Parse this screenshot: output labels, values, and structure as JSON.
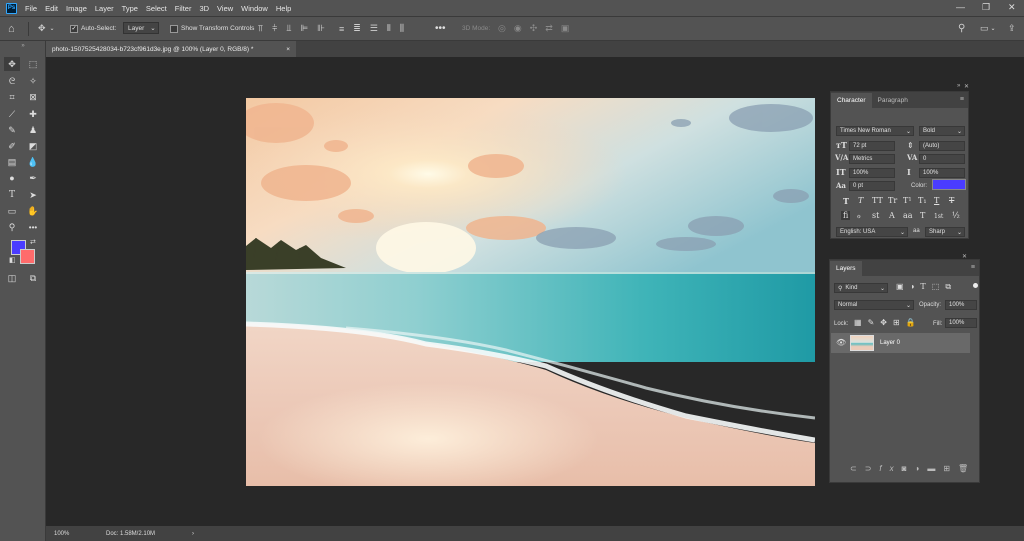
{
  "app": {
    "logo": "Ps"
  },
  "menu": [
    "File",
    "Edit",
    "Image",
    "Layer",
    "Type",
    "Select",
    "Filter",
    "3D",
    "View",
    "Window",
    "Help"
  ],
  "options": {
    "auto_select_label": "Auto-Select:",
    "auto_select_value": "Layer",
    "transform_label": "Show Transform Controls",
    "mode_3d": "3D Mode:"
  },
  "document": {
    "tab_title": "photo-1507525428034-b723cf961d3e.jpg @ 100% (Layer 0, RGB/8) *",
    "close": "×",
    "zoom": "100%",
    "doc_info": "Doc: 1.58M/2.10M",
    "arrow": "›"
  },
  "colors": {
    "foreground": "#4a3cff",
    "background": "#ff6b6b",
    "font_color": "#4a3cff"
  },
  "character": {
    "tabs": [
      "Character",
      "Paragraph"
    ],
    "font_family": "Times New Roman",
    "font_style": "Bold",
    "size": "72 pt",
    "leading": "(Auto)",
    "kerning": "Metrics",
    "tracking": "0",
    "vscale": "100%",
    "hscale": "100%",
    "baseline": "0 pt",
    "color_label": "Color:",
    "type_buttons": [
      "T",
      "T",
      "TT",
      "Tr",
      "T¹",
      "T₁",
      "T",
      "T"
    ],
    "ot_buttons": [
      "fi",
      "ℴ",
      "st",
      "A",
      "aa",
      "T",
      "1st",
      "½"
    ],
    "language": "English: USA",
    "antialias": "Sharp"
  },
  "layers": {
    "title": "Layers",
    "filter": "Kind",
    "blend_mode": "Normal",
    "opacity_label": "Opacity:",
    "opacity": "100%",
    "lock_label": "Lock:",
    "fill_label": "Fill:",
    "fill": "100%",
    "items": [
      {
        "name": "Layer 0",
        "visible": true
      }
    ]
  }
}
